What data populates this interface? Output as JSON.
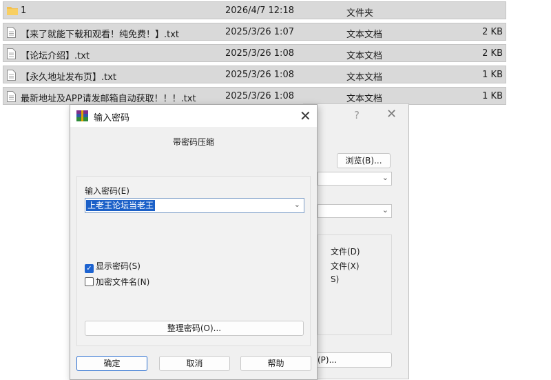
{
  "files": [
    {
      "name": "1",
      "date": "2026/4/7 12:18",
      "type": "文件夹",
      "size": "",
      "icon": "folder-icon"
    },
    {
      "name": "【来了就能下载和观看！纯免费！】.txt",
      "date": "2025/3/26 1:07",
      "type": "文本文档",
      "size": "2 KB",
      "icon": "text-file-icon"
    },
    {
      "name": "【论坛介绍】.txt",
      "date": "2025/3/26 1:08",
      "type": "文本文档",
      "size": "2 KB",
      "icon": "text-file-icon"
    },
    {
      "name": "【永久地址发布页】.txt",
      "date": "2025/3/26 1:08",
      "type": "文本文档",
      "size": "1 KB",
      "icon": "text-file-icon"
    },
    {
      "name": "最新地址及APP请发邮箱自动获取！！！.txt",
      "date": "2025/3/26 1:08",
      "type": "文本文档",
      "size": "1 KB",
      "icon": "text-file-icon"
    }
  ],
  "bg_dialog": {
    "help": "?",
    "close": "✕",
    "browse_label": "浏览(B)...",
    "options": [
      "文件(D)",
      "文件(X)",
      "S)"
    ],
    "button_p": "(P)..."
  },
  "password_dialog": {
    "title": "输入密码",
    "close": "✕",
    "subtitle": "带密码压缩",
    "password_label": "输入密码(E)",
    "password_value": "上老王论坛当老王",
    "show_password_label": "显示密码(S)",
    "show_password_checked": true,
    "encrypt_names_label": "加密文件名(N)",
    "encrypt_names_checked": false,
    "organize_label": "整理密码(O)...",
    "ok_label": "确定",
    "cancel_label": "取消",
    "help_label": "帮助"
  },
  "colors": {
    "selection": "#1b60c8",
    "checkbox_on": "#1d63d0",
    "folder": "#f4c04e",
    "row_bg": "#d9d9d9"
  }
}
